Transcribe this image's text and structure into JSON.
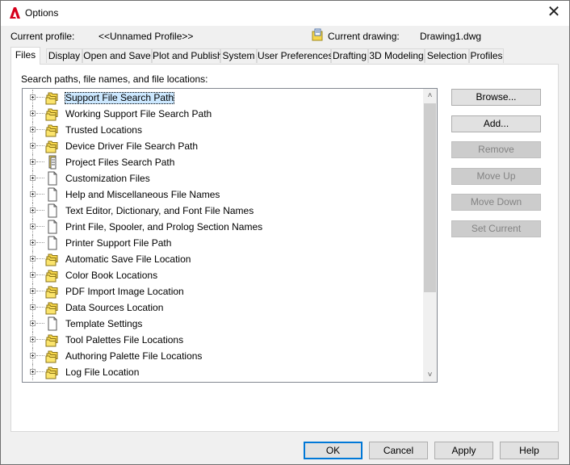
{
  "window": {
    "title": "Options"
  },
  "profile": {
    "current_profile_label": "Current profile:",
    "current_profile_value": "<<Unnamed Profile>>",
    "current_drawing_label": "Current drawing:",
    "current_drawing_value": "Drawing1.dwg"
  },
  "tabs": [
    {
      "label": "Files",
      "active": true
    },
    {
      "label": "Display"
    },
    {
      "label": "Open and Save"
    },
    {
      "label": "Plot and Publish"
    },
    {
      "label": "System"
    },
    {
      "label": "User Preferences"
    },
    {
      "label": "Drafting"
    },
    {
      "label": "3D Modeling"
    },
    {
      "label": "Selection"
    },
    {
      "label": "Profiles"
    }
  ],
  "files": {
    "panel_label": "Search paths, file names, and file locations:",
    "tree": [
      {
        "label": "Support File Search Path",
        "icon": "folder-stack-icon",
        "selected": true
      },
      {
        "label": "Working Support File Search Path",
        "icon": "folder-stack-icon"
      },
      {
        "label": "Trusted Locations",
        "icon": "folder-stack-icon"
      },
      {
        "label": "Device Driver File Search Path",
        "icon": "folder-stack-icon"
      },
      {
        "label": "Project Files Search Path",
        "icon": "project-files-icon"
      },
      {
        "label": "Customization Files",
        "icon": "document-icon"
      },
      {
        "label": "Help and Miscellaneous File Names",
        "icon": "document-icon"
      },
      {
        "label": "Text Editor, Dictionary, and Font File Names",
        "icon": "document-icon"
      },
      {
        "label": "Print File, Spooler, and Prolog Section Names",
        "icon": "document-icon"
      },
      {
        "label": "Printer Support File Path",
        "icon": "document-icon"
      },
      {
        "label": "Automatic Save File Location",
        "icon": "folder-stack-icon"
      },
      {
        "label": "Color Book Locations",
        "icon": "folder-stack-icon"
      },
      {
        "label": "PDF Import Image Location",
        "icon": "folder-stack-icon"
      },
      {
        "label": "Data Sources Location",
        "icon": "folder-stack-icon"
      },
      {
        "label": "Template Settings",
        "icon": "document-icon"
      },
      {
        "label": "Tool Palettes File Locations",
        "icon": "folder-stack-icon"
      },
      {
        "label": "Authoring Palette File Locations",
        "icon": "folder-stack-icon"
      },
      {
        "label": "Log File Location",
        "icon": "folder-stack-icon"
      }
    ],
    "side_buttons": {
      "browse": "Browse...",
      "add": "Add...",
      "remove": "Remove",
      "move_up": "Move Up",
      "move_down": "Move Down",
      "set_current": "Set Current"
    }
  },
  "footer": {
    "ok": "OK",
    "cancel": "Cancel",
    "apply": "Apply",
    "help": "Help"
  },
  "colors": {
    "selection": "#cce8ff",
    "folder_yellow": "#f6d64a",
    "default_button_border": "#0078d7",
    "app_icon_red": "#d6001c"
  }
}
